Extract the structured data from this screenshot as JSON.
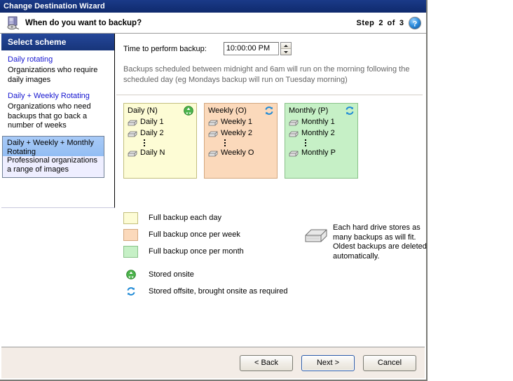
{
  "window": {
    "title": "Change Destination Wizard",
    "header_title": "When do you want to backup?",
    "header_icon": "computer-backup-icon",
    "step": {
      "word_step": "Step",
      "current": "2",
      "word_of": "of",
      "total": "3"
    },
    "help_icon": "help-question-icon"
  },
  "sidebar": {
    "header": "Select scheme",
    "items": [
      {
        "link": "Daily rotating",
        "desc": "Organizations who require daily images",
        "selected": false
      },
      {
        "link": "Daily + Weekly Rotating",
        "desc": "Organizations who need backups that go back a number of weeks",
        "selected": false
      },
      {
        "link": "Daily + Weekly + Monthly Rotating",
        "desc": "Professional organizations a range of images",
        "selected": true
      }
    ]
  },
  "main": {
    "time_label": "Time to perform backup:",
    "time_value": "10:00:00 PM",
    "note": "Backups scheduled between midnight and 6am will run on the morning following the scheduled day (eg Mondays backup will run on Tuesday morning)",
    "boxes": [
      {
        "kind": "daily",
        "title": "Daily (N)",
        "badge_icon": "recycle-green-icon",
        "drives": [
          "Daily 1",
          "Daily 2"
        ],
        "last": "Daily N",
        "color": "#fdfcd5"
      },
      {
        "kind": "weekly",
        "title": "Weekly (O)",
        "badge_icon": "refresh-blue-icon",
        "drives": [
          "Weekly 1",
          "Weekly 2"
        ],
        "last": "Weekly O",
        "color": "#fbd9bb"
      },
      {
        "kind": "monthly",
        "title": "Monthly (P)",
        "badge_icon": "refresh-blue-icon",
        "drives": [
          "Monthly 1",
          "Monthly 2"
        ],
        "last": "Monthly P",
        "color": "#c6f0c6"
      }
    ],
    "legend": [
      {
        "type": "swatch",
        "kind": "daily",
        "label": "Full backup each day"
      },
      {
        "type": "swatch",
        "kind": "weekly",
        "label": "Full backup once per week"
      },
      {
        "type": "swatch",
        "kind": "monthly",
        "label": "Full backup once per month"
      },
      {
        "type": "icon",
        "icon": "recycle-green-icon",
        "label": "Stored onsite"
      },
      {
        "type": "icon",
        "icon": "refresh-blue-icon",
        "label": "Stored offsite, brought onsite as required"
      }
    ],
    "drive_note": {
      "icon": "hard-drive-icon",
      "text": "Each hard drive stores as many backups as will fit. Oldest backups are deleted automatically."
    }
  },
  "buttons": {
    "back": "< Back",
    "back_accel": "B",
    "next": "Next >",
    "next_accel": "N",
    "cancel": "Cancel",
    "cancel_accel": "C"
  }
}
